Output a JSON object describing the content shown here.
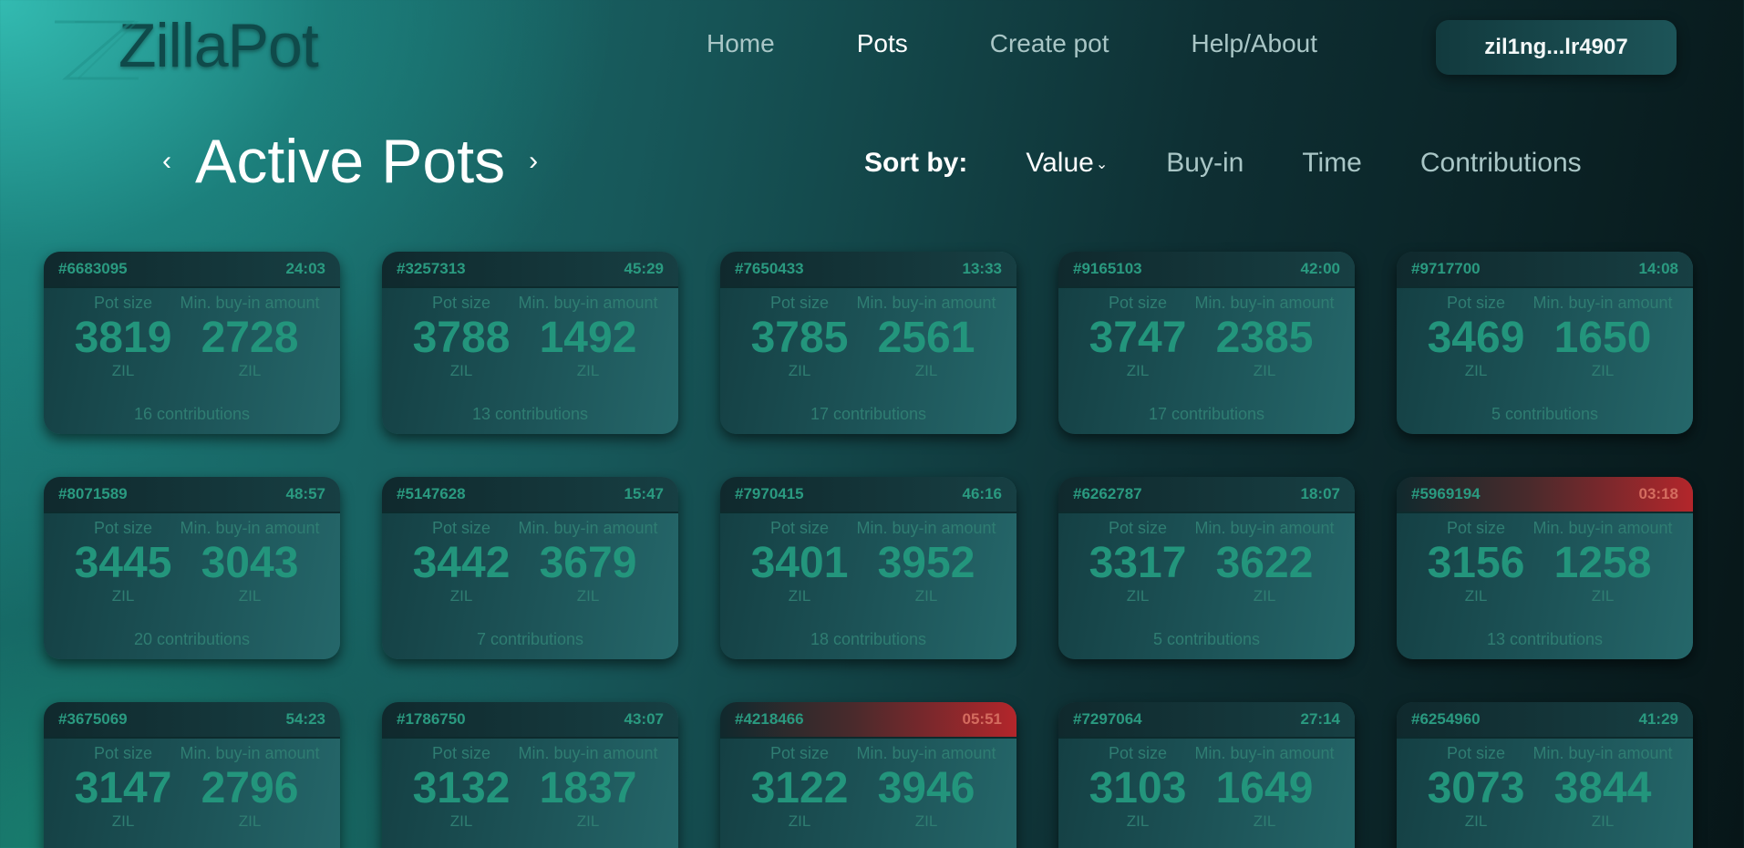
{
  "app": {
    "name": "ZillaPot"
  },
  "nav": {
    "home": "Home",
    "pots": "Pots",
    "create": "Create pot",
    "help": "Help/About"
  },
  "wallet": {
    "address": "zil1ng...lr4907"
  },
  "page": {
    "title": "Active Pots",
    "prev_icon": "chevron-left-icon",
    "next_icon": "chevron-right-icon"
  },
  "sort": {
    "label": "Sort by:",
    "options": [
      "Value",
      "Buy-in",
      "Time",
      "Contributions"
    ],
    "selected": "Value"
  },
  "card_labels": {
    "pot_size": "Pot size",
    "min_buy_in": "Min. buy-in amount",
    "unit": "ZIL"
  },
  "colors": {
    "accent": "#23957c",
    "alert": "#b3262b"
  },
  "pots": [
    {
      "id": "#6683095",
      "time": "24:03",
      "pot": "3819",
      "buyin": "2728",
      "contributions": "16 contributions",
      "alert": false
    },
    {
      "id": "#3257313",
      "time": "45:29",
      "pot": "3788",
      "buyin": "1492",
      "contributions": "13 contributions",
      "alert": false
    },
    {
      "id": "#7650433",
      "time": "13:33",
      "pot": "3785",
      "buyin": "2561",
      "contributions": "17 contributions",
      "alert": false
    },
    {
      "id": "#9165103",
      "time": "42:00",
      "pot": "3747",
      "buyin": "2385",
      "contributions": "17 contributions",
      "alert": false
    },
    {
      "id": "#9717700",
      "time": "14:08",
      "pot": "3469",
      "buyin": "1650",
      "contributions": "5 contributions",
      "alert": false
    },
    {
      "id": "#8071589",
      "time": "48:57",
      "pot": "3445",
      "buyin": "3043",
      "contributions": "20 contributions",
      "alert": false
    },
    {
      "id": "#5147628",
      "time": "15:47",
      "pot": "3442",
      "buyin": "3679",
      "contributions": "7 contributions",
      "alert": false
    },
    {
      "id": "#7970415",
      "time": "46:16",
      "pot": "3401",
      "buyin": "3952",
      "contributions": "18 contributions",
      "alert": false
    },
    {
      "id": "#6262787",
      "time": "18:07",
      "pot": "3317",
      "buyin": "3622",
      "contributions": "5 contributions",
      "alert": false
    },
    {
      "id": "#5969194",
      "time": "03:18",
      "pot": "3156",
      "buyin": "1258",
      "contributions": "13 contributions",
      "alert": true
    },
    {
      "id": "#3675069",
      "time": "54:23",
      "pot": "3147",
      "buyin": "2796",
      "contributions": "",
      "alert": false
    },
    {
      "id": "#1786750",
      "time": "43:07",
      "pot": "3132",
      "buyin": "1837",
      "contributions": "",
      "alert": false
    },
    {
      "id": "#4218466",
      "time": "05:51",
      "pot": "3122",
      "buyin": "3946",
      "contributions": "",
      "alert": true
    },
    {
      "id": "#7297064",
      "time": "27:14",
      "pot": "3103",
      "buyin": "1649",
      "contributions": "",
      "alert": false
    },
    {
      "id": "#6254960",
      "time": "41:29",
      "pot": "3073",
      "buyin": "3844",
      "contributions": "",
      "alert": false
    }
  ]
}
